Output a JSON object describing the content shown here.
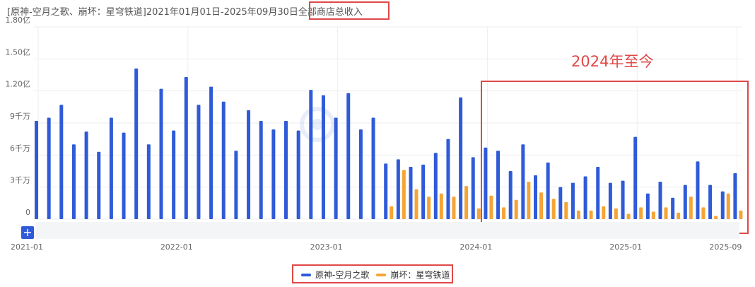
{
  "header": {
    "title": "[原神-空月之歌、崩坏：星穹铁道]2021年01月01日-2025年09月30日全部商店总收入"
  },
  "annotation": {
    "text": "2024年至今"
  },
  "colors": {
    "genshin": "#2f5ad8",
    "hsr": "#f5a436",
    "grid": "#eeeeee",
    "highlight": "#e04848"
  },
  "controls": {
    "zoom_label": "+"
  },
  "chart_data": {
    "type": "bar",
    "title": "[原神-空月之歌、崩坏：星穹铁道]2021年01月01日-2025年09月30日全部商店总收入",
    "ylim": [
      0,
      18000
    ],
    "y_ticks": [
      0,
      3000,
      6000,
      9000,
      12000,
      15000,
      18000
    ],
    "y_tick_labels": [
      "0",
      "3千万",
      "6千万",
      "9千万",
      "1.20亿",
      "1.50亿",
      "1.80亿"
    ],
    "x_tick_labels": [
      {
        "label": "2021-01",
        "index": 0
      },
      {
        "label": "2022-01",
        "index": 12
      },
      {
        "label": "2023-01",
        "index": 24
      },
      {
        "label": "2024-01",
        "index": 36
      },
      {
        "label": "2025-01",
        "index": 48
      },
      {
        "label": "2025-09",
        "index": 56
      }
    ],
    "categories": [
      "2021-01",
      "2021-02",
      "2021-03",
      "2021-04",
      "2021-05",
      "2021-06",
      "2021-07",
      "2021-08",
      "2021-09",
      "2021-10",
      "2021-11",
      "2021-12",
      "2022-01",
      "2022-02",
      "2022-03",
      "2022-04",
      "2022-05",
      "2022-06",
      "2022-07",
      "2022-08",
      "2022-09",
      "2022-10",
      "2022-11",
      "2022-12",
      "2023-01",
      "2023-02",
      "2023-03",
      "2023-04",
      "2023-05",
      "2023-06",
      "2023-07",
      "2023-08",
      "2023-09",
      "2023-10",
      "2023-11",
      "2023-12",
      "2024-01",
      "2024-02",
      "2024-03",
      "2024-04",
      "2024-05",
      "2024-06",
      "2024-07",
      "2024-08",
      "2024-09",
      "2024-10",
      "2024-11",
      "2024-12",
      "2025-01",
      "2025-02",
      "2025-03",
      "2025-04",
      "2025-05",
      "2025-06",
      "2025-07",
      "2025-08",
      "2025-09"
    ],
    "series": [
      {
        "name": "原神-空月之歌",
        "values": [
          9200,
          9500,
          10700,
          7000,
          8200,
          6300,
          9500,
          8100,
          14100,
          7000,
          12200,
          8300,
          13300,
          10700,
          12400,
          11000,
          6400,
          10200,
          9200,
          8400,
          9200,
          8300,
          12100,
          11600,
          9500,
          11800,
          8400,
          9500,
          5200,
          5600,
          4900,
          5100,
          6200,
          7500,
          11400,
          5800,
          6700,
          6400,
          4500,
          7000,
          4100,
          5300,
          3000,
          3400,
          4000,
          4900,
          3400,
          3600,
          7700,
          2400,
          3500,
          2000,
          3200,
          5400,
          3200,
          2600,
          4300
        ]
      },
      {
        "name": "崩坏：星穹铁道",
        "values": [
          null,
          null,
          null,
          null,
          null,
          null,
          null,
          null,
          null,
          null,
          null,
          null,
          null,
          null,
          null,
          null,
          null,
          null,
          null,
          null,
          null,
          null,
          null,
          null,
          null,
          null,
          null,
          null,
          1200,
          4600,
          2800,
          2100,
          2400,
          2100,
          3100,
          1000,
          2200,
          1100,
          1800,
          3500,
          2500,
          1900,
          1600,
          800,
          800,
          1200,
          1000,
          500,
          1100,
          700,
          1100,
          600,
          2100,
          1100,
          300,
          2400,
          800
        ]
      }
    ]
  }
}
